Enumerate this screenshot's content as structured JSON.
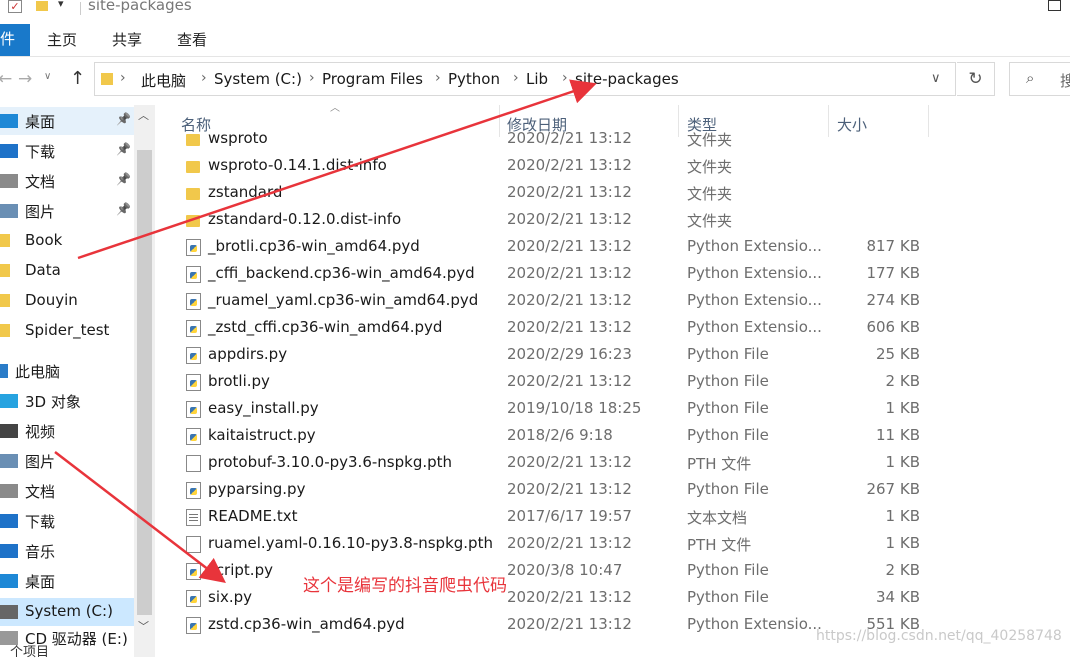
{
  "window": {
    "title": "site-packages"
  },
  "ribbon": {
    "tabs": [
      "件",
      "主页",
      "共享",
      "查看"
    ]
  },
  "address": {
    "crumbs": [
      "此电脑",
      "System (C:)",
      "Program Files",
      "Python",
      "Lib",
      "site-packages"
    ],
    "search_placeholder": "搜"
  },
  "nav": {
    "items": [
      {
        "label": "桌面",
        "icon": "desktop-icon",
        "pinned": true
      },
      {
        "label": "下载",
        "icon": "download-icon",
        "pinned": true
      },
      {
        "label": "文档",
        "icon": "document-icon",
        "pinned": true
      },
      {
        "label": "图片",
        "icon": "pictures-icon",
        "pinned": true
      },
      {
        "label": "Book",
        "icon": "folder-icon",
        "pinned": false
      },
      {
        "label": "Data",
        "icon": "folder-icon",
        "pinned": false
      },
      {
        "label": "Douyin",
        "icon": "folder-icon",
        "pinned": false
      },
      {
        "label": "Spider_test",
        "icon": "folder-icon",
        "pinned": false
      },
      {
        "label": "此电脑",
        "icon": "computer-icon",
        "pinned": false
      },
      {
        "label": "3D 对象",
        "icon": "3d-objects-icon",
        "pinned": false
      },
      {
        "label": "视频",
        "icon": "video-icon",
        "pinned": false
      },
      {
        "label": "图片",
        "icon": "pictures-icon",
        "pinned": false
      },
      {
        "label": "文档",
        "icon": "document-icon",
        "pinned": false
      },
      {
        "label": "下载",
        "icon": "download-icon",
        "pinned": false
      },
      {
        "label": "音乐",
        "icon": "music-icon",
        "pinned": false
      },
      {
        "label": "桌面",
        "icon": "desktop-icon",
        "pinned": false
      },
      {
        "label": "System (C:)",
        "icon": "drive-icon",
        "pinned": false
      },
      {
        "label": "CD 驱动器 (E:)",
        "icon": "cd-drive-icon",
        "pinned": false
      }
    ]
  },
  "columns": {
    "name": "名称",
    "date": "修改日期",
    "type": "类型",
    "size": "大小"
  },
  "files": [
    {
      "name": "wsproto",
      "date": "2020/2/21 13:12",
      "type": "文件夹",
      "size": "",
      "kind": "folder"
    },
    {
      "name": "wsproto-0.14.1.dist-info",
      "date": "2020/2/21 13:12",
      "type": "文件夹",
      "size": "",
      "kind": "folder"
    },
    {
      "name": "zstandard",
      "date": "2020/2/21 13:12",
      "type": "文件夹",
      "size": "",
      "kind": "folder"
    },
    {
      "name": "zstandard-0.12.0.dist-info",
      "date": "2020/2/21 13:12",
      "type": "文件夹",
      "size": "",
      "kind": "folder"
    },
    {
      "name": "_brotli.cp36-win_amd64.pyd",
      "date": "2020/2/21 13:12",
      "type": "Python Extensio...",
      "size": "817 KB",
      "kind": "py"
    },
    {
      "name": "_cffi_backend.cp36-win_amd64.pyd",
      "date": "2020/2/21 13:12",
      "type": "Python Extensio...",
      "size": "177 KB",
      "kind": "py"
    },
    {
      "name": "_ruamel_yaml.cp36-win_amd64.pyd",
      "date": "2020/2/21 13:12",
      "type": "Python Extensio...",
      "size": "274 KB",
      "kind": "py"
    },
    {
      "name": "_zstd_cffi.cp36-win_amd64.pyd",
      "date": "2020/2/21 13:12",
      "type": "Python Extensio...",
      "size": "606 KB",
      "kind": "py"
    },
    {
      "name": "appdirs.py",
      "date": "2020/2/29 16:23",
      "type": "Python File",
      "size": "25 KB",
      "kind": "py"
    },
    {
      "name": "brotli.py",
      "date": "2020/2/21 13:12",
      "type": "Python File",
      "size": "2 KB",
      "kind": "py"
    },
    {
      "name": "easy_install.py",
      "date": "2019/10/18 18:25",
      "type": "Python File",
      "size": "1 KB",
      "kind": "py"
    },
    {
      "name": "kaitaistruct.py",
      "date": "2018/2/6 9:18",
      "type": "Python File",
      "size": "11 KB",
      "kind": "py"
    },
    {
      "name": "protobuf-3.10.0-py3.6-nspkg.pth",
      "date": "2020/2/21 13:12",
      "type": "PTH 文件",
      "size": "1 KB",
      "kind": "blank"
    },
    {
      "name": "pyparsing.py",
      "date": "2020/2/21 13:12",
      "type": "Python File",
      "size": "267 KB",
      "kind": "py"
    },
    {
      "name": "README.txt",
      "date": "2017/6/17 19:57",
      "type": "文本文档",
      "size": "1 KB",
      "kind": "txt"
    },
    {
      "name": "ruamel.yaml-0.16.10-py3.8-nspkg.pth",
      "date": "2020/2/21 13:12",
      "type": "PTH 文件",
      "size": "1 KB",
      "kind": "blank"
    },
    {
      "name": "script.py",
      "date": "2020/3/8 10:47",
      "type": "Python File",
      "size": "2 KB",
      "kind": "py"
    },
    {
      "name": "six.py",
      "date": "2020/2/21 13:12",
      "type": "Python File",
      "size": "34 KB",
      "kind": "py"
    },
    {
      "name": "zstd.cp36-win_amd64.pyd",
      "date": "2020/2/21 13:12",
      "type": "Python Extensio...",
      "size": "551 KB",
      "kind": "py"
    }
  ],
  "annotation": "这个是编写的抖音爬虫代码",
  "watermark": "https://blog.csdn.net/qq_40258748",
  "status": {
    "item_count": "个项目"
  },
  "colors": {
    "accent": "#1979ca",
    "annotation": "#e8343b",
    "folder": "#f1c84b"
  }
}
